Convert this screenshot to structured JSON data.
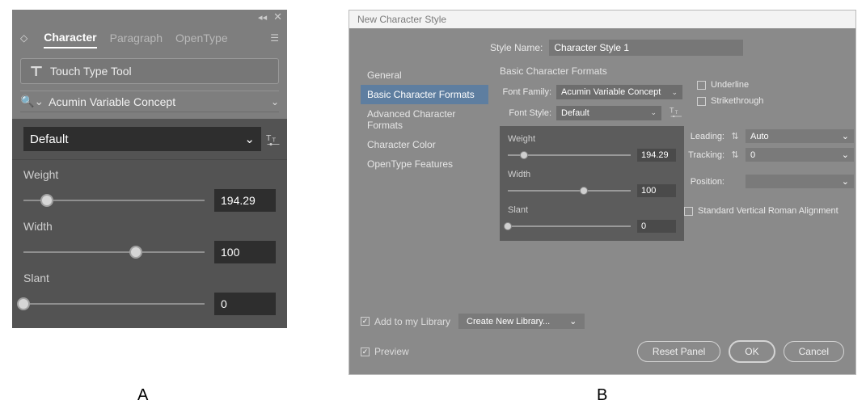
{
  "panel_a": {
    "tabs": {
      "character": "Character",
      "paragraph": "Paragraph",
      "opentype": "OpenType"
    },
    "touch_type_tool": "Touch Type Tool",
    "font_family": "Acumin Variable Concept",
    "font_style": "Default",
    "sliders": {
      "weight": {
        "label": "Weight",
        "value": "194.29",
        "pos": 13
      },
      "width": {
        "label": "Width",
        "value": "100",
        "pos": 62
      },
      "slant": {
        "label": "Slant",
        "value": "0",
        "pos": 0
      }
    }
  },
  "dialog_b": {
    "title": "New Character Style",
    "style_name_label": "Style Name:",
    "style_name_value": "Character Style 1",
    "side_items": [
      "General",
      "Basic Character Formats",
      "Advanced Character Formats",
      "Character Color",
      "OpenType Features"
    ],
    "section_title": "Basic Character Formats",
    "font_family_label": "Font Family:",
    "font_family_value": "Acumin Variable Concept",
    "font_style_label": "Font Style:",
    "font_style_value": "Default",
    "mini_sliders": {
      "weight": {
        "label": "Weight",
        "value": "194.29",
        "pos": 13
      },
      "width": {
        "label": "Width",
        "value": "100",
        "pos": 62
      },
      "slant": {
        "label": "Slant",
        "value": "0",
        "pos": 0
      }
    },
    "underline": "Underline",
    "strikethrough": "Strikethrough",
    "leading_label": "Leading:",
    "leading_value": "Auto",
    "tracking_label": "Tracking:",
    "tracking_value": "0",
    "position_label": "Position:",
    "position_value": "",
    "svra": "Standard Vertical Roman Alignment",
    "add_library_label": "Add to my Library",
    "new_library_label": "Create New Library...",
    "preview_label": "Preview",
    "reset_panel": "Reset Panel",
    "ok": "OK",
    "cancel": "Cancel"
  },
  "caption_a": "A",
  "caption_b": "B"
}
